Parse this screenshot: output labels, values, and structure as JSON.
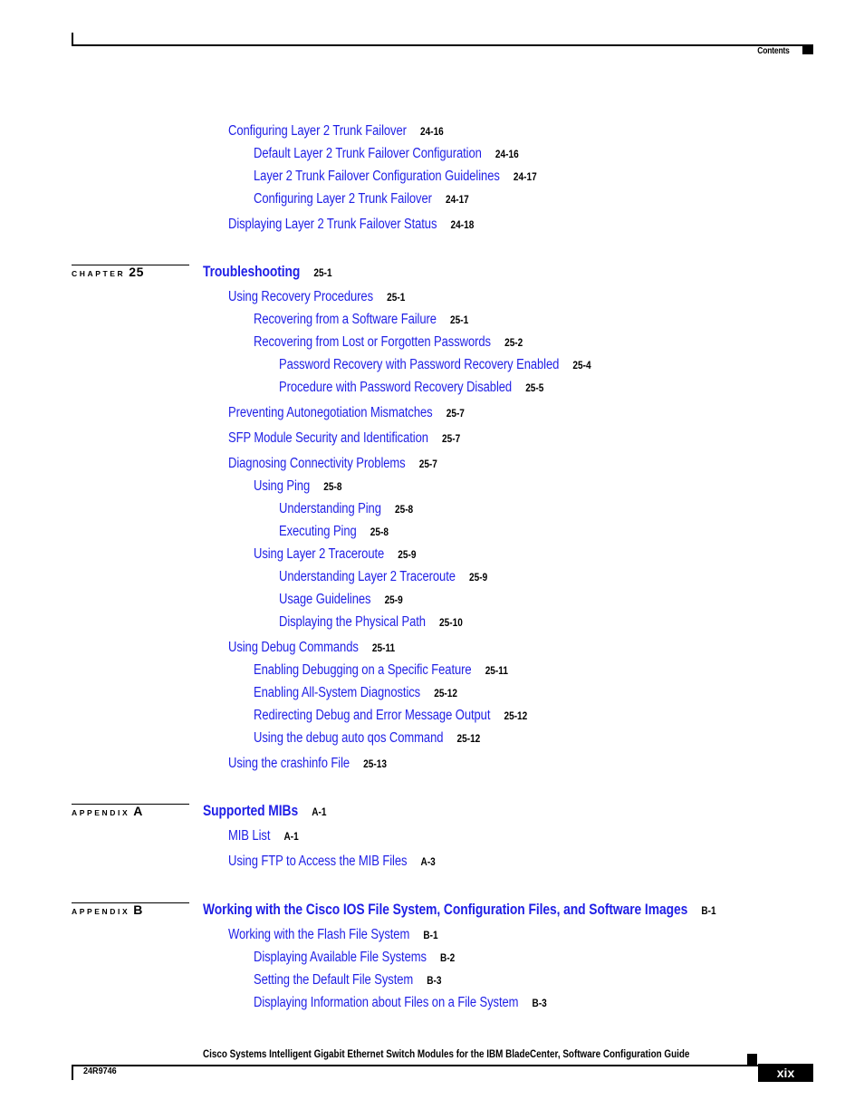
{
  "header": {
    "section_label": "Contents"
  },
  "toc_continued": [
    {
      "title": "Configuring Layer 2 Trunk Failover",
      "page": "24-16",
      "level": 1
    },
    {
      "title": "Default Layer 2 Trunk Failover Configuration",
      "page": "24-16",
      "level": 2
    },
    {
      "title": "Layer 2 Trunk Failover Configuration Guidelines",
      "page": "24-17",
      "level": 2
    },
    {
      "title": "Configuring Layer 2 Trunk Failover",
      "page": "24-17",
      "level": 2
    },
    {
      "title": "Displaying Layer 2 Trunk Failover Status",
      "page": "24-18",
      "level": 1
    }
  ],
  "chapters": [
    {
      "kind": "CHAPTER",
      "number": "25",
      "title": "Troubleshooting",
      "page": "25-1",
      "entries": [
        {
          "title": "Using Recovery Procedures",
          "page": "25-1",
          "level": 1
        },
        {
          "title": "Recovering from a Software Failure",
          "page": "25-1",
          "level": 2
        },
        {
          "title": "Recovering from Lost or Forgotten Passwords",
          "page": "25-2",
          "level": 2
        },
        {
          "title": "Password Recovery with Password Recovery Enabled",
          "page": "25-4",
          "level": 3
        },
        {
          "title": "Procedure with Password Recovery Disabled",
          "page": "25-5",
          "level": 3
        },
        {
          "title": "Preventing Autonegotiation Mismatches",
          "page": "25-7",
          "level": 1
        },
        {
          "title": "SFP Module Security and Identification",
          "page": "25-7",
          "level": 1
        },
        {
          "title": "Diagnosing Connectivity Problems",
          "page": "25-7",
          "level": 1
        },
        {
          "title": "Using Ping",
          "page": "25-8",
          "level": 2
        },
        {
          "title": "Understanding Ping",
          "page": "25-8",
          "level": 3
        },
        {
          "title": "Executing Ping",
          "page": "25-8",
          "level": 3
        },
        {
          "title": "Using Layer 2 Traceroute",
          "page": "25-9",
          "level": 2
        },
        {
          "title": "Understanding Layer 2 Traceroute",
          "page": "25-9",
          "level": 3
        },
        {
          "title": "Usage Guidelines",
          "page": "25-9",
          "level": 3
        },
        {
          "title": "Displaying the Physical Path",
          "page": "25-10",
          "level": 3
        },
        {
          "title": "Using Debug Commands",
          "page": "25-11",
          "level": 1
        },
        {
          "title": "Enabling Debugging on a Specific Feature",
          "page": "25-11",
          "level": 2
        },
        {
          "title": "Enabling All-System Diagnostics",
          "page": "25-12",
          "level": 2
        },
        {
          "title": "Redirecting Debug and Error Message Output",
          "page": "25-12",
          "level": 2
        },
        {
          "title": "Using the debug auto qos Command",
          "page": "25-12",
          "level": 2
        },
        {
          "title": "Using the crashinfo File",
          "page": "25-13",
          "level": 1
        }
      ]
    },
    {
      "kind": "APPENDIX",
      "number": "A",
      "title": "Supported MIBs",
      "page": "A-1",
      "entries": [
        {
          "title": "MIB List",
          "page": "A-1",
          "level": 1
        },
        {
          "title": "Using FTP to Access the MIB Files",
          "page": "A-3",
          "level": 1
        }
      ]
    },
    {
      "kind": "APPENDIX",
      "number": "B",
      "title": "Working with the Cisco IOS File System, Configuration Files, and Software Images",
      "page": "B-1",
      "entries": [
        {
          "title": "Working with the Flash File System",
          "page": "B-1",
          "level": 1
        },
        {
          "title": "Displaying Available File Systems",
          "page": "B-2",
          "level": 2
        },
        {
          "title": "Setting the Default File System",
          "page": "B-3",
          "level": 2
        },
        {
          "title": "Displaying Information about Files on a File System",
          "page": "B-3",
          "level": 2
        }
      ]
    }
  ],
  "footer": {
    "book_title": "Cisco Systems Intelligent Gigabit Ethernet Switch Modules for the IBM BladeCenter, Software Configuration Guide",
    "doc_number": "24R9746",
    "page_number": "xix"
  },
  "colors": {
    "link": "#1f1fe6",
    "text": "#000000"
  }
}
